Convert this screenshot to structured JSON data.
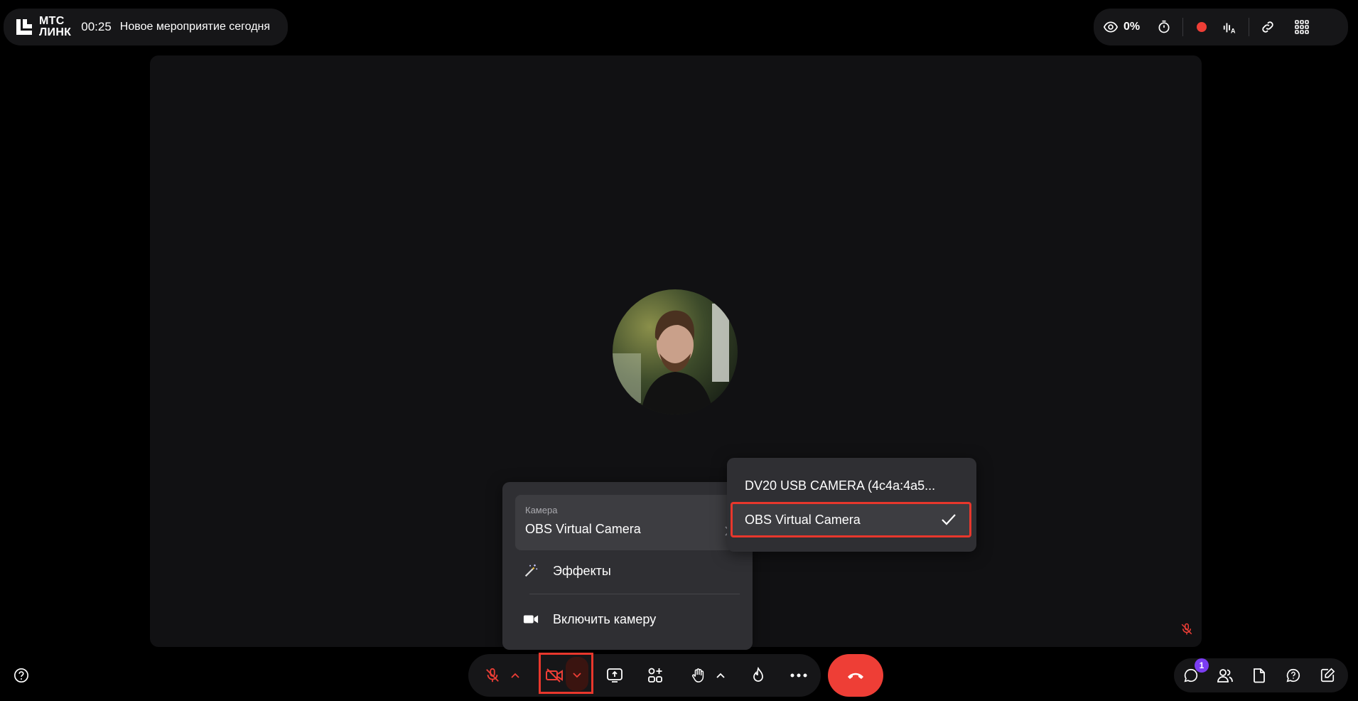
{
  "header": {
    "logo_text_line1": "МТС",
    "logo_text_line2": "ЛИНК",
    "timer": "00:25",
    "event_title": "Новое мероприятие сегодня",
    "viewers_percent": "0%"
  },
  "camera_menu": {
    "caption": "Камера",
    "selected_camera": "OBS Virtual Camera",
    "items": [
      {
        "label": "Эффекты",
        "icon": "magic-wand-icon"
      },
      {
        "label": "Включить камеру",
        "icon": "video-camera-icon"
      }
    ]
  },
  "camera_submenu": {
    "options": [
      {
        "label": "DV20 USB CAMERA (4c4a:4a5...",
        "selected": false
      },
      {
        "label": "OBS Virtual Camera",
        "selected": true
      }
    ]
  },
  "right_bar": {
    "chat_badge": "1"
  },
  "colors": {
    "accent_red": "#ee3e36",
    "highlight_red": "#e8372c",
    "badge_purple": "#7b3df2",
    "menu_bg": "#2f2f33"
  }
}
